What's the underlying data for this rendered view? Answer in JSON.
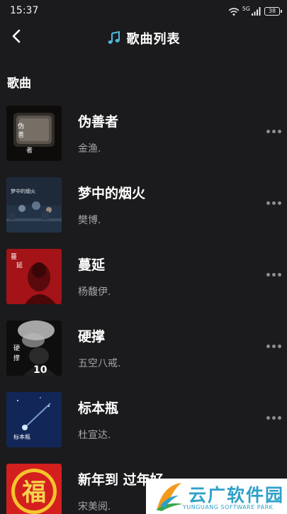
{
  "status_bar": {
    "time": "15:37",
    "network_label": "5G",
    "battery_level": "38"
  },
  "header": {
    "title": "歌曲列表",
    "back_icon": "chevron-left-icon",
    "title_icon": "music-note-icon"
  },
  "section": {
    "title": "歌曲"
  },
  "songs": [
    {
      "title": "伪善者",
      "artist": "金渔.",
      "cover_text": [
        "伪",
        "善",
        "者"
      ]
    },
    {
      "title": "梦中的烟火",
      "artist": "樊博.",
      "cover_text": [
        "梦中的烟火"
      ]
    },
    {
      "title": "蔓延",
      "artist": "杨馥伊.",
      "cover_text": [
        "蔓",
        "延"
      ]
    },
    {
      "title": "硬撑",
      "artist": "五空八戒.",
      "cover_text": [
        "硬",
        "撑",
        "10"
      ]
    },
    {
      "title": "标本瓶",
      "artist": "杜宣达.",
      "cover_text": [
        "标本瓶"
      ]
    },
    {
      "title": "新年到 过年好",
      "artist": "宋美阅.",
      "cover_text": [
        "福"
      ]
    }
  ],
  "watermark": {
    "title": "云广软件园",
    "subtitle": "YUNGUANG SOFTWARE PARK"
  },
  "colors": {
    "background": "#1b1b1d",
    "title_text": "#ffffff",
    "secondary_text": "#a5a5a8",
    "more_dots": "#8e8e92",
    "watermark_blue": "#2fa1c8"
  }
}
